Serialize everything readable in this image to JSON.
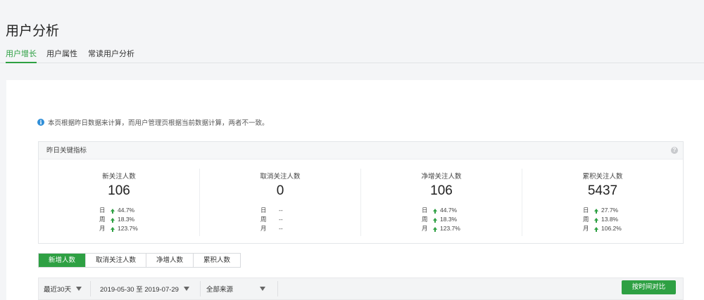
{
  "page_title": "用户分析",
  "tabs": [
    {
      "label": "用户增长",
      "active": true
    },
    {
      "label": "用户属性",
      "active": false
    },
    {
      "label": "常读用户分析",
      "active": false
    }
  ],
  "notice": "本页根据昨日数据来计算，而用户管理页根据当前数据计算，两者不一致。",
  "kpi": {
    "title": "昨日关键指标",
    "items": [
      {
        "label": "新关注人数",
        "value": "106",
        "rows": [
          {
            "k": "日",
            "v": "44.7%",
            "arrow": "up"
          },
          {
            "k": "周",
            "v": "18.3%",
            "arrow": "up"
          },
          {
            "k": "月",
            "v": "123.7%",
            "arrow": "up"
          }
        ]
      },
      {
        "label": "取消关注人数",
        "value": "0",
        "rows": [
          {
            "k": "日",
            "v": "--",
            "arrow": "none"
          },
          {
            "k": "周",
            "v": "--",
            "arrow": "none"
          },
          {
            "k": "月",
            "v": "--",
            "arrow": "none"
          }
        ]
      },
      {
        "label": "净增关注人数",
        "value": "106",
        "rows": [
          {
            "k": "日",
            "v": "44.7%",
            "arrow": "up"
          },
          {
            "k": "周",
            "v": "18.3%",
            "arrow": "up"
          },
          {
            "k": "月",
            "v": "123.7%",
            "arrow": "up"
          }
        ]
      },
      {
        "label": "累积关注人数",
        "value": "5437",
        "rows": [
          {
            "k": "日",
            "v": "27.7%",
            "arrow": "up"
          },
          {
            "k": "周",
            "v": "13.8%",
            "arrow": "up"
          },
          {
            "k": "月",
            "v": "106.2%",
            "arrow": "up"
          }
        ]
      }
    ]
  },
  "segments": [
    {
      "label": "新增人数",
      "active": true
    },
    {
      "label": "取消关注人数",
      "active": false
    },
    {
      "label": "净增人数",
      "active": false
    },
    {
      "label": "累积人数",
      "active": false
    }
  ],
  "filters": {
    "period": "最近30天",
    "date_range": "2019-05-30 至 2019-07-29",
    "source": "全部来源",
    "compare_label": "按时间对比"
  },
  "colors": {
    "accent": "#2ea043",
    "info": "#2f8ed8"
  }
}
